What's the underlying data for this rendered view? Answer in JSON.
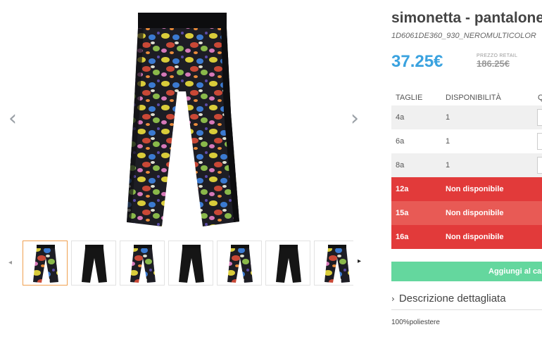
{
  "product": {
    "title": "simonetta - pantalone",
    "sku": "1D6061DE360_930_NEROMULTICOLOR",
    "price": "37.25€",
    "retail_label": "PREZZO RETAIL",
    "retail_price": "186.25€"
  },
  "gallery": {
    "prev_icon": "‹",
    "next_icon": "›",
    "thumb_prev_icon": "◂",
    "thumb_next_icon": "▸",
    "thumbnails": [
      {
        "variant": "floral",
        "active": true
      },
      {
        "variant": "black"
      },
      {
        "variant": "floral"
      },
      {
        "variant": "black"
      },
      {
        "variant": "floral"
      },
      {
        "variant": "black"
      },
      {
        "variant": "floral"
      }
    ]
  },
  "sizes_table": {
    "headers": {
      "size": "TAGLIE",
      "availability": "DISPONIBILITÀ",
      "qty": "Q"
    },
    "rows": [
      {
        "size": "4a",
        "availability": "1",
        "status": "available"
      },
      {
        "size": "6a",
        "availability": "1",
        "status": "available"
      },
      {
        "size": "8a",
        "availability": "1",
        "status": "available"
      },
      {
        "size": "12a",
        "availability": "Non disponibile",
        "status": "unavailable"
      },
      {
        "size": "15a",
        "availability": "Non disponibile",
        "status": "unavailable"
      },
      {
        "size": "16a",
        "availability": "Non disponibile",
        "status": "unavailable"
      }
    ]
  },
  "cart_button": "Aggiungi al carr",
  "description": {
    "chevron_icon": "›",
    "heading": "Descrizione dettagliata",
    "text": "100%poliestere"
  },
  "colors": {
    "price": "#3aa2df",
    "cart": "#64d79e",
    "unavailable_1": "#e23a3a",
    "unavailable_2": "#e85a55",
    "active_thumb_border": "#f0a050"
  }
}
